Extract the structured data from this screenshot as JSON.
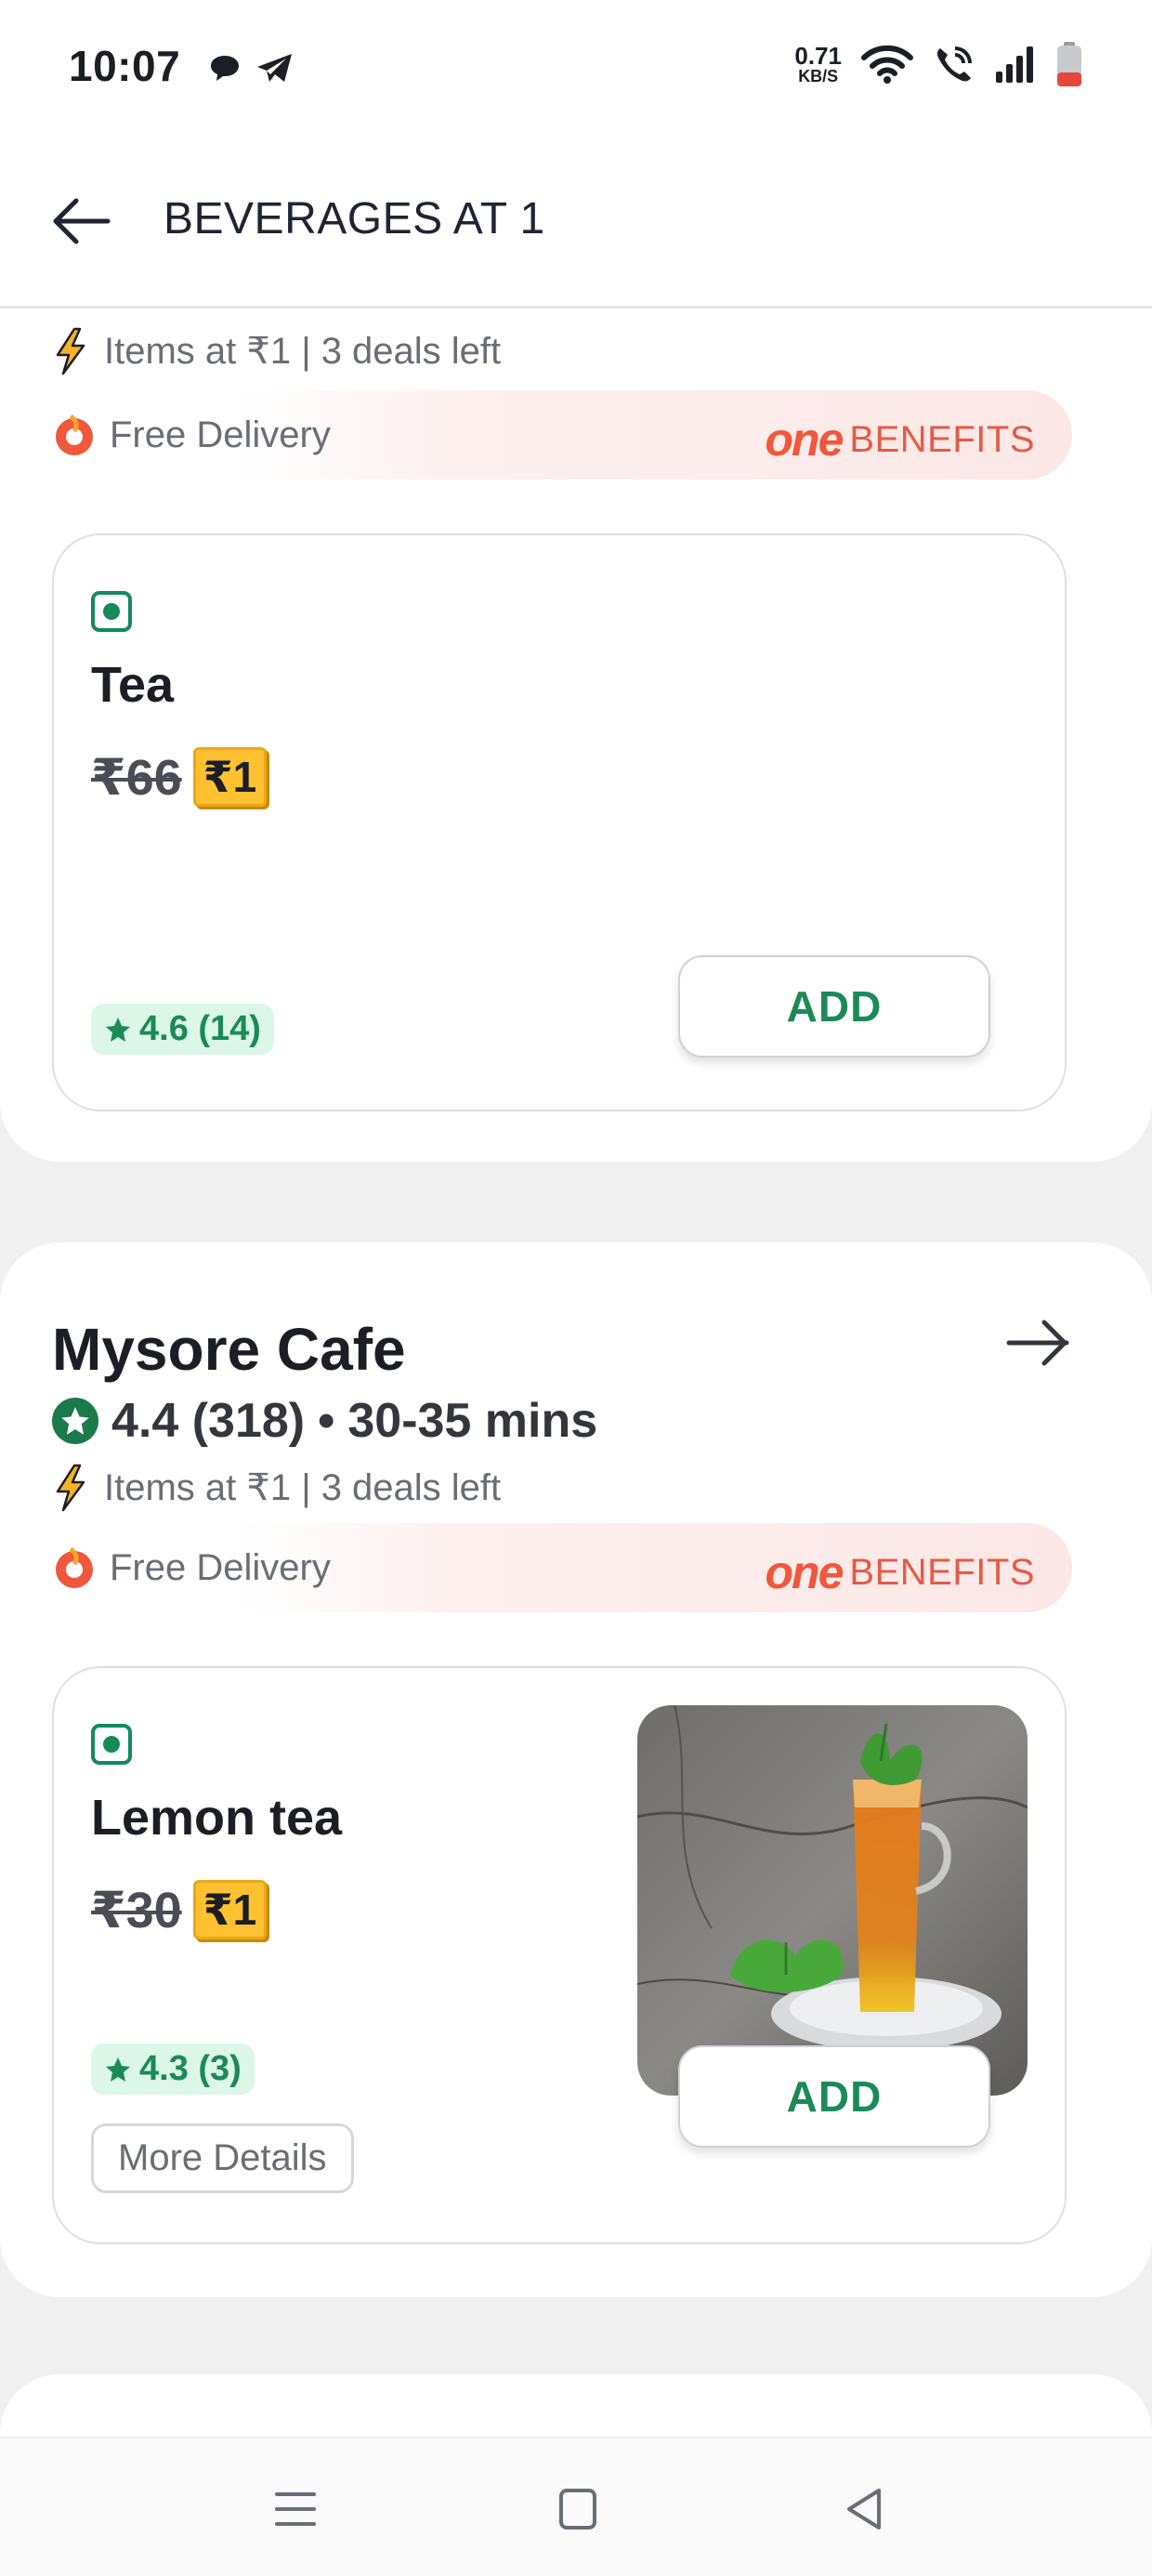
{
  "status_bar": {
    "time": "10:07",
    "net_speed_value": "0.71",
    "net_speed_unit": "KB/S",
    "icons": [
      "chat-icon",
      "telegram-icon",
      "wifi-icon",
      "wifi-call-icon",
      "signal-icon",
      "battery-icon"
    ]
  },
  "header": {
    "title": "BEVERAGES AT 1",
    "back_icon": "arrow-left-icon"
  },
  "restaurants": [
    {
      "deals": "Items at ₹1 | 3 deals left",
      "free_delivery": "Free Delivery",
      "one_logo": "one",
      "benefits": "BENEFITS",
      "item": {
        "name": "Tea",
        "old_price": "₹66",
        "new_price": "₹1",
        "rating": "4.6 (14)",
        "add_label": "ADD"
      }
    },
    {
      "name": "Mysore Cafe",
      "rating": "4.4 (318)",
      "eta": "30-35 mins",
      "deals": "Items at ₹1 | 3 deals left",
      "free_delivery": "Free Delivery",
      "one_logo": "one",
      "benefits": "BENEFITS",
      "item": {
        "name": "Lemon tea",
        "old_price": "₹30",
        "new_price": "₹1",
        "rating": "4.3 (3)",
        "add_label": "ADD",
        "more_details": "More Details"
      }
    }
  ],
  "colors": {
    "accent_green": "#1b8a57",
    "price_badge": "#ffc12f",
    "one_brand": "#f0573b",
    "background": "#f0f0f1"
  }
}
